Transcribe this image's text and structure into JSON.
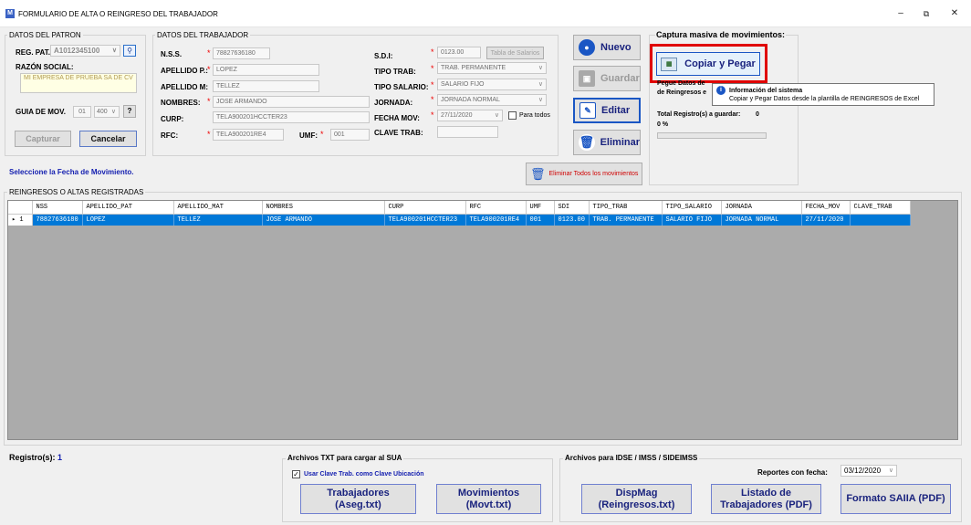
{
  "window": {
    "title": "FORMULARIO DE ALTA O REINGRESO DEL TRABAJADOR",
    "app_icon": "M"
  },
  "patron": {
    "group_label": "DATOS DEL PATRON",
    "reg_pat_label": "REG. PAT.",
    "reg_pat_value": "A1012345100",
    "razon_social_label": "RAZÓN SOCIAL:",
    "razon_social_value": "MI EMPRESA DE PRUEBA SA DE CV",
    "guia_label": "GUIA DE MOV.",
    "guia_value1": "01",
    "guia_value2": "400",
    "help_label": "?",
    "capturar_label": "Capturar",
    "cancelar_label": "Cancelar"
  },
  "trabajador": {
    "group_label": "DATOS DEL TRABAJADOR",
    "nss_label": "N.S.S.",
    "nss_value": "78827636180",
    "apellido_p_label": "APELLIDO P.:",
    "apellido_p_value": "LOPEZ",
    "apellido_m_label": "APELLIDO M:",
    "apellido_m_value": "TELLEZ",
    "nombres_label": "NOMBRES:",
    "nombres_value": "JOSE ARMANDO",
    "curp_label": "CURP:",
    "curp_value": "TELA900201HCCTER23",
    "rfc_label": "RFC:",
    "rfc_value": "TELA900201RE4",
    "umf_label": "UMF:",
    "umf_value": "001",
    "sdi_label": "S.D.I:",
    "sdi_value": "0123.00",
    "tabla_salarios_label": "Tabla de Salarios",
    "tipo_trab_label": "TIPO TRAB:",
    "tipo_trab_value": "TRAB. PERMANENTE",
    "tipo_salario_label": "TIPO SALARIO:",
    "tipo_salario_value": "SALARIO FIJO",
    "jornada_label": "JORNADA:",
    "jornada_value": "JORNADA NORMAL",
    "fecha_mov_label": "FECHA MOV:",
    "fecha_mov_value": "27/11/2020",
    "para_todos_label": "Para todos",
    "clave_trab_label": "CLAVE TRAB:",
    "clave_trab_value": ""
  },
  "actions": {
    "nuevo": "Nuevo",
    "guardar": "Guardar",
    "editar": "Editar",
    "eliminar": "Eliminar",
    "eliminar_todos": "Eliminar Todos los movimientos"
  },
  "captura": {
    "title": "Captura masiva de movimientos:",
    "copiar_pegar": "Copiar y Pegar",
    "pegue_line1": "Pegue Datos de",
    "pegue_line2": "de Reingresos e",
    "total_label": "Total Registro(s) a guardar:",
    "total_value": "0",
    "percent": "0 %",
    "progress": 0
  },
  "tooltip": {
    "title": "Información del sistema",
    "body": "Copiar y Pegar Datos desde la plantilla de REINGRESOS de Excel"
  },
  "hint": "Seleccione la Fecha de Movimiento.",
  "grid": {
    "label": "REINGRESOS O ALTAS REGISTRADAS",
    "columns": [
      "NSS",
      "APELLIDO_PAT",
      "APELLIDO_MAT",
      "NOMBRES",
      "CURP",
      "RFC",
      "UMF",
      "SDI",
      "TIPO_TRAB",
      "TIPO_SALARIO",
      "JORNADA",
      "FECHA_MOV",
      "CLAVE_TRAB"
    ],
    "rows": [
      {
        "index": "1",
        "cells": [
          "78827636180",
          "LOPEZ",
          "TELLEZ",
          "JOSE ARMANDO",
          "TELA900201HCCTER23",
          "TELA900201RE4",
          "001",
          "0123.00",
          "TRAB. PERMANENTE",
          "SALARIO FIJO",
          "JORNADA NORMAL",
          "27/11/2020",
          ""
        ]
      }
    ]
  },
  "footer": {
    "registros_label": "Registro(s):",
    "registros_value": "1",
    "txt_group": "Archivos  TXT para cargar al SUA",
    "usar_clave_label": "Usar Clave Trab. como Clave Ubicación",
    "trabajadores_l1": "Trabajadores",
    "trabajadores_l2": "(Aseg.txt)",
    "movimientos_l1": "Movimientos",
    "movimientos_l2": "(Movt.txt)",
    "idse_group": "Archivos para IDSE / IMSS / SIDEIMSS",
    "reportes_label": "Reportes con fecha:",
    "reportes_fecha": "03/12/2020",
    "dispmag_l1": "DispMag",
    "dispmag_l2": "(Reingresos.txt)",
    "listado_l1": "Listado de",
    "listado_l2": "Trabajadores (PDF)",
    "formato_saiia": "Formato SAIIA (PDF)"
  },
  "colors": {
    "accent": "#0078d7",
    "highlight_border": "#e00000",
    "label_blue": "#1a237e"
  }
}
